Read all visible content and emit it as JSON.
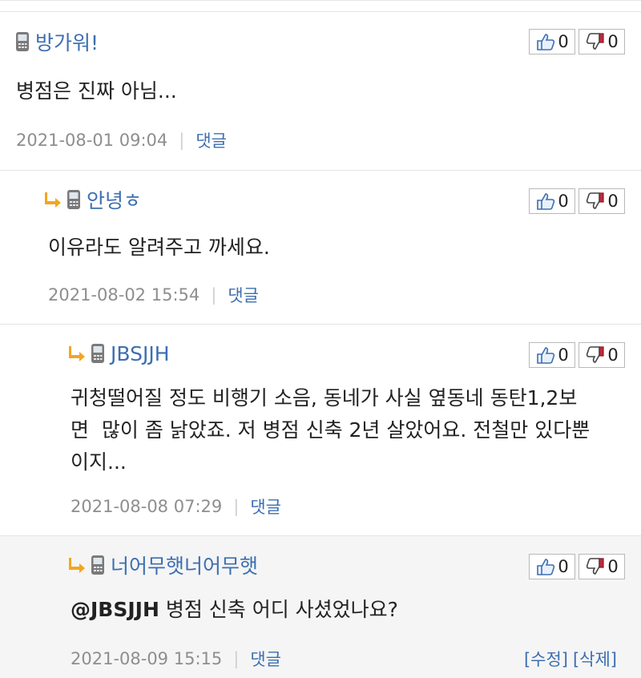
{
  "colors": {
    "author": "#3d6fb0",
    "meta": "#8e8e8e",
    "reply_arrow": "#f2a61f",
    "highlight_bg": "#f5f5f5"
  },
  "comments": [
    {
      "author": "방가워!",
      "text": "병점은 진짜 아님...",
      "timestamp": "2021-08-01 09:04",
      "reply_label": "댓글",
      "likes": "0",
      "dislikes": "0"
    },
    {
      "author": "안녕ㅎ",
      "text": "이유라도 알려주고 까세요.",
      "timestamp": "2021-08-02 15:54",
      "reply_label": "댓글",
      "likes": "0",
      "dislikes": "0"
    },
    {
      "author": "JBSJJH",
      "text_lines": [
        "귀청떨어질 정도 비행기 소음, 동네가 사실 옆동네 동탄1,2보",
        "면  많이 좀 낡았죠. 저 병점 신축 2년 살았어요. 전철만 있다뿐",
        "이지..."
      ],
      "timestamp": "2021-08-08 07:29",
      "reply_label": "댓글",
      "likes": "0",
      "dislikes": "0"
    },
    {
      "author": "너어무햇너어무햇",
      "mention": "@JBSJJH",
      "text": " 병점 신축 어디 사셨었나요?",
      "timestamp": "2021-08-09 15:15",
      "reply_label": "댓글",
      "edit_label": "[수정]",
      "delete_label": "[삭제]",
      "likes": "0",
      "dislikes": "0"
    }
  ]
}
